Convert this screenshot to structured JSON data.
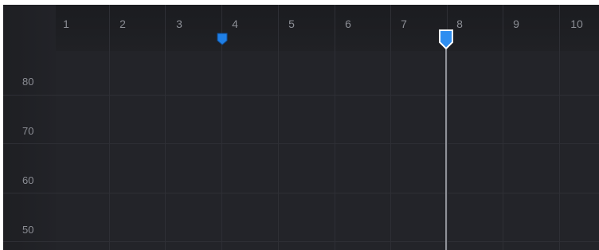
{
  "timeline": {
    "x_ruler": {
      "ticks": [
        "1",
        "2",
        "3",
        "4",
        "5",
        "6",
        "7",
        "8",
        "9",
        "10"
      ]
    },
    "y_ruler": {
      "ticks": [
        "80",
        "70",
        "60",
        "50"
      ]
    },
    "markers": {
      "keyframe_marker": {
        "color": "#1f7fe6",
        "icon": "keyframe-marker-icon"
      },
      "playhead": {
        "color": "#2f8ef0",
        "icon": "playhead-handle-icon"
      }
    },
    "colors": {
      "background": "#232429",
      "grid": "#2e2f35",
      "label": "#8b8d94",
      "playhead_line": "#8f9198"
    }
  }
}
